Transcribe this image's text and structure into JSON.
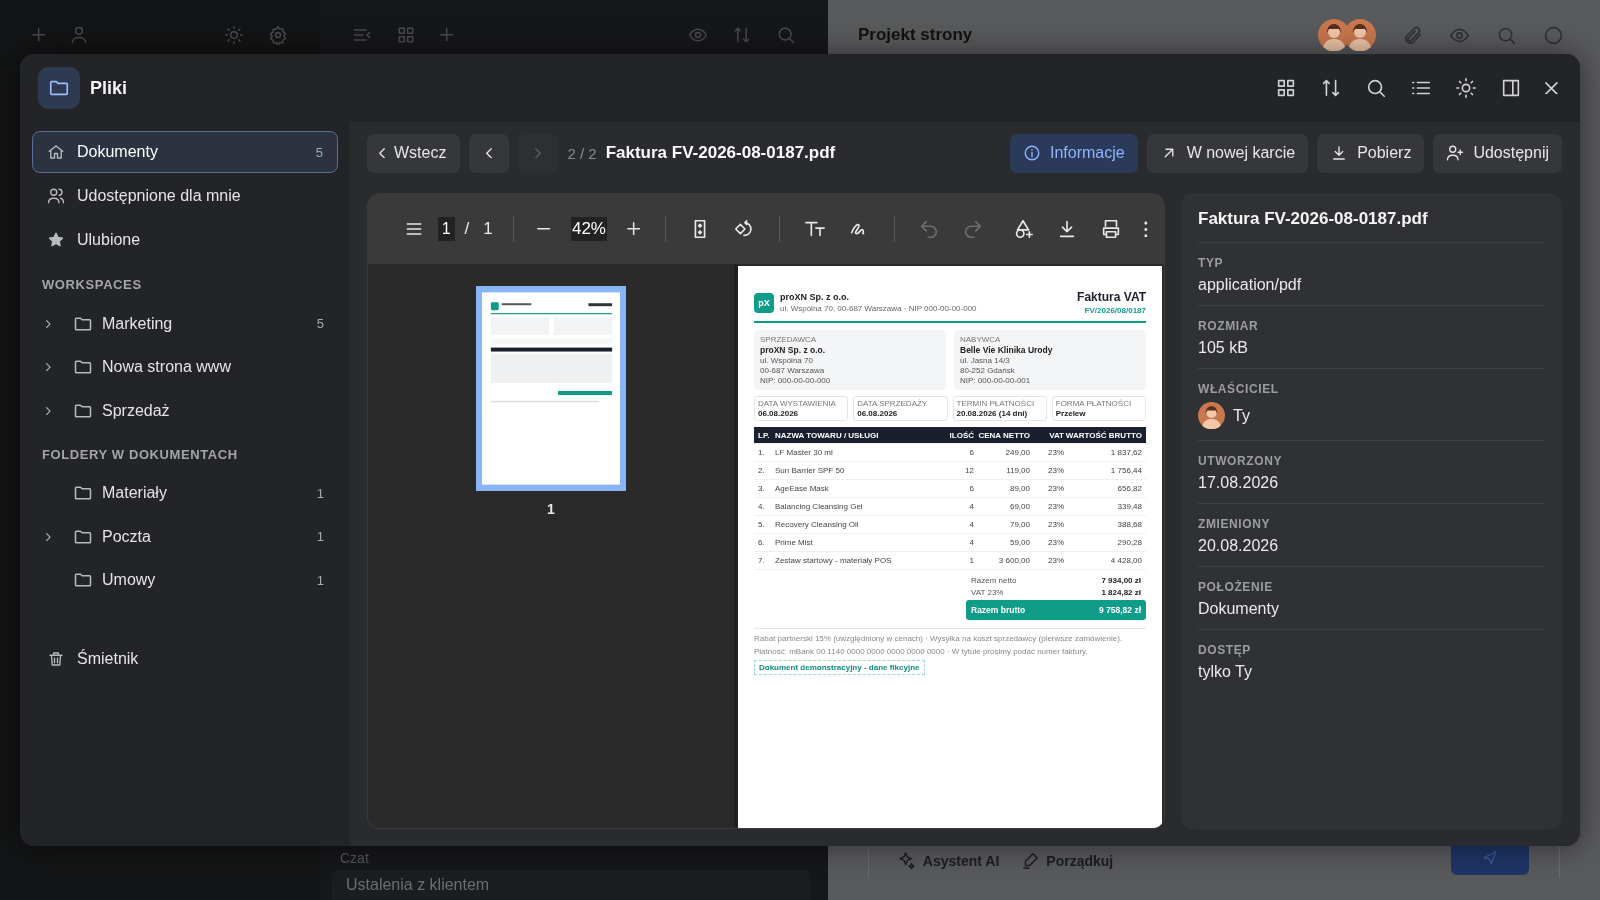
{
  "background": {
    "project_title": "Projekt strony",
    "chat_label": "Czat",
    "chat_item": "Ustalenia z klientem",
    "composer_actions": [
      {
        "kind": "sparkle",
        "label": "Asystent AI"
      },
      {
        "kind": "brush",
        "label": "Porządkuj"
      }
    ]
  },
  "modal": {
    "title": "Pliki"
  },
  "sidebar": {
    "items": [
      {
        "kind": "home",
        "label": "Dokumenty",
        "count": "5",
        "selected": true
      },
      {
        "kind": "users",
        "label": "Udostępnione dla mnie",
        "selected": false
      },
      {
        "kind": "star",
        "label": "Ulubione",
        "selected": false
      }
    ],
    "sections": [
      {
        "heading": "WORKSPACES",
        "folders": [
          {
            "label": "Marketing",
            "count": "5",
            "expandable": true
          },
          {
            "label": "Nowa strona www",
            "expandable": true
          },
          {
            "label": "Sprzedaż",
            "expandable": true
          }
        ]
      },
      {
        "heading": "FOLDERY W DOKUMENTACH",
        "folders": [
          {
            "label": "Materiały",
            "count": "1",
            "expandable": false
          },
          {
            "label": "Poczta",
            "count": "1",
            "expandable": true
          },
          {
            "label": "Umowy",
            "count": "1",
            "expandable": false
          }
        ]
      }
    ],
    "trash": "Śmietnik"
  },
  "toolbar": {
    "back": "Wstecz",
    "nav": [
      {
        "kind": "prev",
        "disabled": false
      },
      {
        "kind": "next",
        "disabled": true
      }
    ],
    "position": "2 / 2",
    "file_name": "Faktura FV-2026-08-0187.pdf",
    "actions": [
      {
        "kind": "info",
        "label": "Informacje",
        "selected": true
      },
      {
        "kind": "external",
        "label": "W nowej karcie",
        "selected": false
      },
      {
        "kind": "download",
        "label": "Pobierz",
        "selected": false
      },
      {
        "kind": "user-plus",
        "label": "Udostępnij",
        "selected": false
      }
    ]
  },
  "viewer": {
    "page_input": "1",
    "separator": "/",
    "page_total": "1",
    "zoom": "42%",
    "tools": [
      {
        "kind": "fit",
        "disabled": false
      },
      {
        "kind": "rotate",
        "disabled": false
      },
      {
        "kind": "text",
        "disabled": false
      },
      {
        "kind": "draw",
        "disabled": false
      },
      {
        "kind": "undo",
        "disabled": true
      },
      {
        "kind": "redo",
        "disabled": true
      },
      {
        "kind": "shapes",
        "disabled": false
      },
      {
        "kind": "download",
        "disabled": false
      },
      {
        "kind": "print",
        "disabled": false
      },
      {
        "kind": "more",
        "disabled": false
      }
    ],
    "thumbnail_label": "1",
    "document": {
      "logo": "pX",
      "company": "proXN Sp. z o.o.",
      "company_address": "ul. Wspólna 70, 00-687 Warszawa · NIP 000-00-00-000",
      "title": "Faktura VAT",
      "number": "FV/2026/08/0187",
      "parties": [
        {
          "label": "SPRZEDAWCA",
          "name": "proXN Sp. z o.o.",
          "lines": [
            "ul. Wspólna 70",
            "00-687 Warszawa",
            "NIP: 000-00-00-000"
          ]
        },
        {
          "label": "NABYWCA",
          "name": "Belle Vie Klinika Urody",
          "lines": [
            "ul. Jasna 14/3",
            "80-252 Gdańsk",
            "NIP: 000-00-00-001"
          ]
        }
      ],
      "dates": [
        {
          "label": "DATA WYSTAWIENIA",
          "value": "06.08.2026"
        },
        {
          "label": "DATA SPRZEDAŻY",
          "value": "06.08.2026"
        },
        {
          "label": "TERMIN PŁATNOŚCI",
          "value": "20.08.2026 (14 dni)"
        },
        {
          "label": "FORMA PŁATNOŚCI",
          "value": "Przelew"
        }
      ],
      "columns": [
        "LP.",
        "NAZWA TOWARU / USŁUGI",
        "ILOŚĆ",
        "CENA NETTO",
        "VAT",
        "WARTOŚĆ BRUTTO"
      ],
      "rows": [
        [
          "1.",
          "LF Master 30 ml",
          "6",
          "249,00",
          "23%",
          "1 837,62"
        ],
        [
          "2.",
          "Sun Barrier SPF 50",
          "12",
          "119,00",
          "23%",
          "1 756,44"
        ],
        [
          "3.",
          "AgeEase Mask",
          "6",
          "89,00",
          "23%",
          "656,82"
        ],
        [
          "4.",
          "Balancing Cleansing Gel",
          "4",
          "69,00",
          "23%",
          "339,48"
        ],
        [
          "5.",
          "Recovery Cleansing Oil",
          "4",
          "79,00",
          "23%",
          "388,68"
        ],
        [
          "6.",
          "Prime Mist",
          "4",
          "59,00",
          "23%",
          "290,28"
        ],
        [
          "7.",
          "Zestaw startowy - materiały POS",
          "1",
          "3 600,00",
          "23%",
          "4 428,00"
        ]
      ],
      "totals": [
        {
          "label": "Razem netto",
          "value": "7 934,00 zł"
        },
        {
          "label": "VAT 23%",
          "value": "1 824,82 zł"
        }
      ],
      "grand_total": {
        "label": "Razem brutto",
        "value": "9 758,82 zł"
      },
      "notes": [
        "Rabat partnerski 15% (uwzględniony w cenach) · Wysyłka na koszt sprzedawcy (pierwsze zamówienie).",
        "Płatność: mBank 00 1140 0000 0000 0000 0000 0000 · W tytule prosimy podać numer faktury."
      ],
      "stamp": "Dokument demonstracyjny - dane fikcyjne"
    }
  },
  "info": {
    "title": "Faktura FV-2026-08-0187.pdf",
    "fields": [
      {
        "kind": "text",
        "label": "TYP",
        "value": "application/pdf"
      },
      {
        "kind": "text",
        "label": "ROZMIAR",
        "value": "105 kB"
      },
      {
        "kind": "owner",
        "label": "WŁAŚCICIEL",
        "value": "Ty"
      },
      {
        "kind": "text",
        "label": "UTWORZONY",
        "value": "17.08.2026"
      },
      {
        "kind": "text",
        "label": "ZMIENIONY",
        "value": "20.08.2026"
      },
      {
        "kind": "text",
        "label": "POŁOŻENIE",
        "value": "Dokumenty"
      },
      {
        "kind": "text",
        "label": "DOSTĘP",
        "value": "tylko Ty"
      }
    ]
  }
}
